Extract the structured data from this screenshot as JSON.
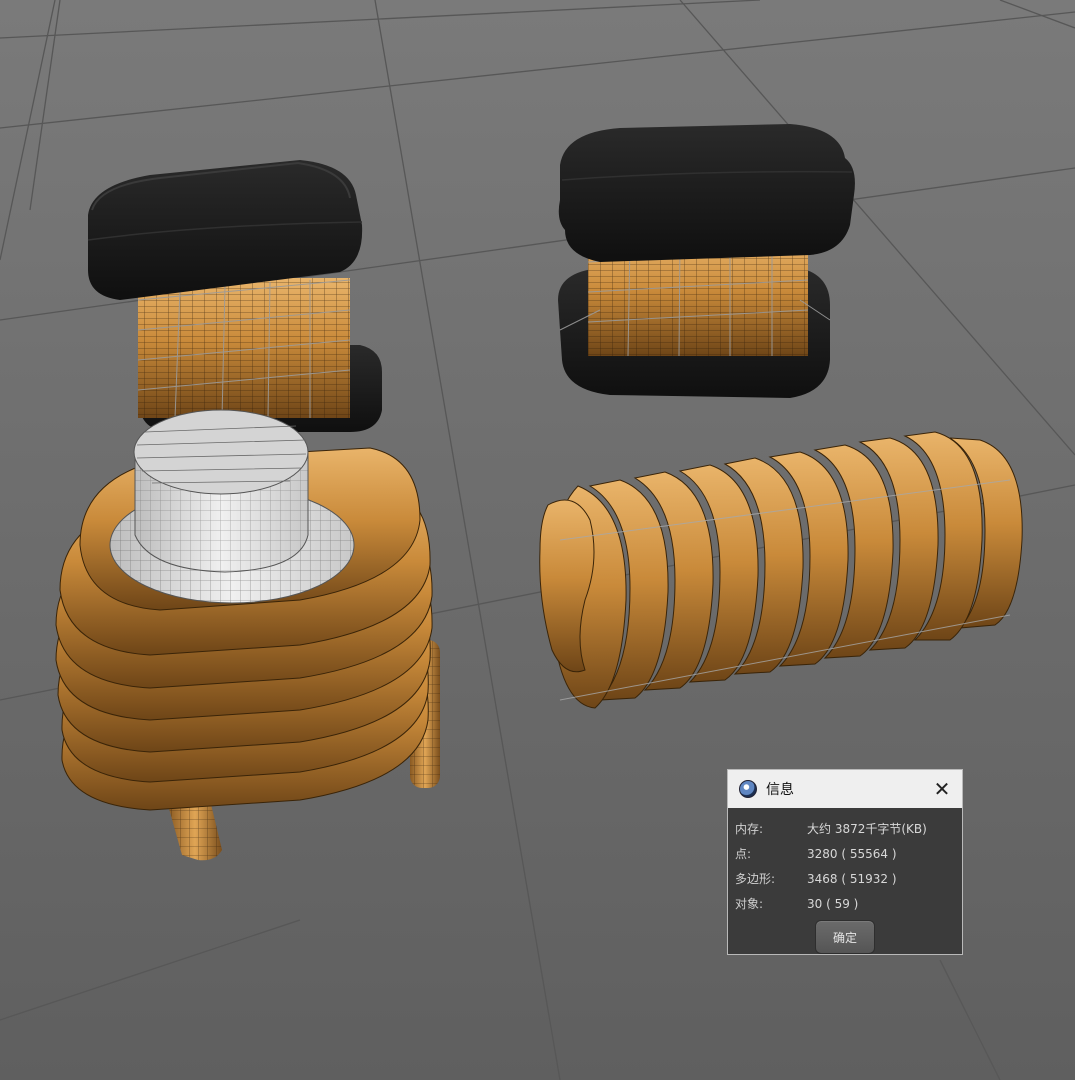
{
  "dialog": {
    "title": "信息",
    "icon": "cinema4d-app-icon",
    "close_icon": "close-icon",
    "rows": [
      {
        "label": "内存:",
        "value": "大约 3872千字节(KB)"
      },
      {
        "label": "点:",
        "value": "3280 ( 55564 )"
      },
      {
        "label": "多边形:",
        "value": "3468 ( 51932 )"
      },
      {
        "label": "对象:",
        "value": "30 ( 59 )"
      }
    ],
    "ok_label": "确定"
  },
  "scene": {
    "background_color": "#6c6c6c",
    "grid_color": "#5a5a5a",
    "copper_color": "#c98a3a",
    "ferrite_color": "#1c1c1c",
    "core_color": "#d9d9d9"
  }
}
